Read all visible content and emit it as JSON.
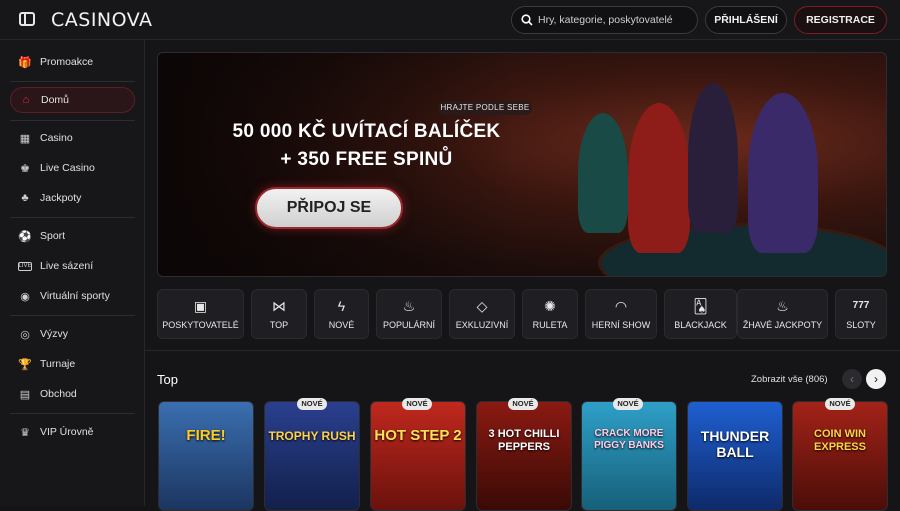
{
  "brand": {
    "name": "CASINOVA"
  },
  "header": {
    "search_placeholder": "Hry, kategorie, poskytovatelé",
    "login_label": "PŘIHLÁŠENÍ",
    "register_label": "REGISTRACE"
  },
  "sidebar": {
    "items": [
      {
        "label": "Promoakce",
        "icon": "gift-icon"
      },
      {
        "label": "Domů",
        "icon": "home-icon",
        "active": true
      },
      {
        "label": "Casino",
        "icon": "slot-machine-icon"
      },
      {
        "label": "Live Casino",
        "icon": "live-dealer-icon"
      },
      {
        "label": "Jackpoty",
        "icon": "clover-icon"
      },
      {
        "label": "Sport",
        "icon": "soccer-ball-icon"
      },
      {
        "label": "Live sázení",
        "icon": "live-badge-icon"
      },
      {
        "label": "Virtuální sporty",
        "icon": "virtual-sports-icon"
      },
      {
        "label": "Výzvy",
        "icon": "target-icon"
      },
      {
        "label": "Turnaje",
        "icon": "trophy-icon"
      },
      {
        "label": "Obchod",
        "icon": "shop-icon"
      },
      {
        "label": "VIP Úrovně",
        "icon": "crown-icon"
      }
    ]
  },
  "banner": {
    "tag": "HRAJTE PODLE SEBE",
    "headline_1": "50 000 KČ UVÍTACÍ BALÍČEK",
    "headline_2": "+ 350 FREE SPINŮ",
    "cta_label": "PŘIPOJ SE"
  },
  "categories": [
    {
      "label": "POSKYTOVATELÉ",
      "icon": "provider-card-icon"
    },
    {
      "label": "TOP",
      "icon": "bow-tie-icon"
    },
    {
      "label": "NOVÉ",
      "icon": "lightning-icon"
    },
    {
      "label": "POPULÁRNÍ",
      "icon": "flame-icon"
    },
    {
      "label": "EXKLUZIVNÍ",
      "icon": "diamond-icon"
    },
    {
      "label": "RULETA",
      "icon": "roulette-icon"
    },
    {
      "label": "HERNÍ SHOW",
      "icon": "mask-icon"
    },
    {
      "label": "BLACKJACK",
      "icon": "cards-icon"
    },
    {
      "label": "ŽHAVÉ JACKPOTY",
      "icon": "hot-jackpot-icon"
    },
    {
      "label": "SLOTY",
      "icon": "777-icon"
    }
  ],
  "top_section": {
    "title": "Top",
    "see_all_label": "Zobrazit vše (806)",
    "prev_icon": "chevron-left-icon",
    "next_icon": "chevron-right-icon"
  },
  "games": [
    {
      "name": "FIRE!",
      "badge": "",
      "bg": "#3a6fb0"
    },
    {
      "name": "TROPHY RUSH",
      "badge": "NOVÉ",
      "bg": "#2a3f8f"
    },
    {
      "name": "HOT STEP 2",
      "badge": "NOVÉ",
      "bg": "#c0281e"
    },
    {
      "name": "3 HOT CHILLI PEPPERS",
      "badge": "NOVÉ",
      "bg": "#8a1a12"
    },
    {
      "name": "CRACK MORE PIGGY BANKS",
      "badge": "NOVÉ",
      "bg": "#2f9fc8"
    },
    {
      "name": "THUNDER BALL",
      "badge": "",
      "bg": "#1e5fd0"
    },
    {
      "name": "COIN WIN EXPRESS",
      "badge": "NOVÉ",
      "bg": "#a32218"
    }
  ]
}
